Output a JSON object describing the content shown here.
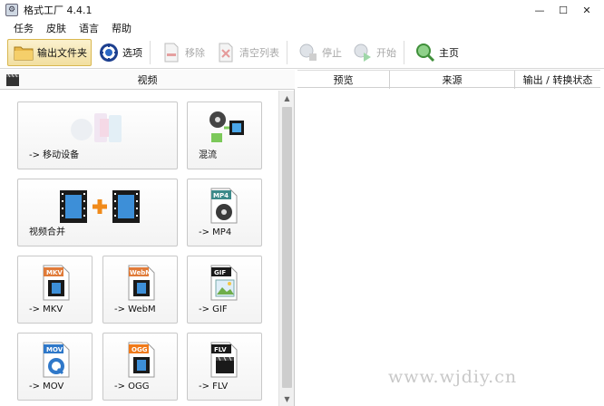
{
  "window": {
    "title": "格式工厂 4.4.1",
    "minimize": "—",
    "maximize": "☐",
    "close": "✕"
  },
  "menu": [
    "任务",
    "皮肤",
    "语言",
    "帮助"
  ],
  "toolbar": {
    "output_folder": "输出文件夹",
    "options": "选项",
    "remove": "移除",
    "clear_list": "清空列表",
    "stop": "停止",
    "start": "开始",
    "home": "主页"
  },
  "left": {
    "category": "视频",
    "tiles": [
      {
        "label": "-> 移动设备",
        "icon": "mobile-device-icon"
      },
      {
        "label": "混流",
        "icon": "mux-icon"
      },
      {
        "label": "视频合并",
        "icon": "video-join-icon"
      },
      {
        "label": "-> MP4",
        "icon": "mp4-file-icon",
        "badge": "MP4"
      },
      {
        "label": "-> MKV",
        "icon": "mkv-file-icon",
        "badge": "MKV"
      },
      {
        "label": "-> WebM",
        "icon": "webm-file-icon",
        "badge": "WebM"
      },
      {
        "label": "-> GIF",
        "icon": "gif-file-icon",
        "badge": "GIF"
      },
      {
        "label": "-> MOV",
        "icon": "mov-file-icon",
        "badge": "MOV"
      },
      {
        "label": "-> OGG",
        "icon": "ogg-file-icon",
        "badge": "OGG"
      },
      {
        "label": "-> FLV",
        "icon": "flv-file-icon",
        "badge": "FLV"
      }
    ]
  },
  "table": {
    "columns": [
      "预览",
      "来源",
      "输出 / 转换状态"
    ]
  },
  "watermark": "www.wjdiy.cn",
  "colors": {
    "mkv_badge": "#e07b39",
    "webm_badge": "#e07b39",
    "mov_badge": "#2f78c9",
    "ogg_badge": "#f07a1a",
    "dark_badge": "#1a1a1a",
    "mp4_badge": "#3d8a8a"
  }
}
